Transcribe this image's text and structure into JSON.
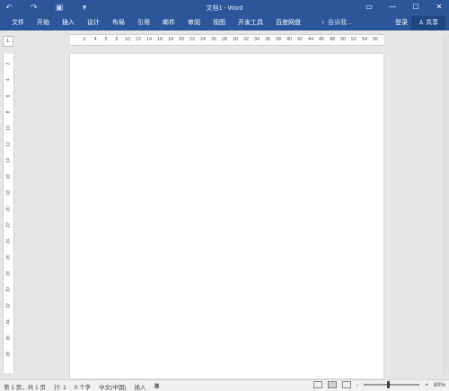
{
  "window": {
    "title": "文档1 - Word"
  },
  "qat": {
    "undo_icon": "undo-icon",
    "redo_icon": "redo-icon",
    "save_icon": "save-icon",
    "customize_icon": "chevron-down-icon"
  },
  "ribbon": {
    "tabs": [
      "文件",
      "开始",
      "插入",
      "设计",
      "布局",
      "引用",
      "邮件",
      "审阅",
      "视图",
      "开发工具",
      "百度网盘"
    ],
    "tell_me": "告诉我...",
    "sign_in": "登录",
    "share": "共享"
  },
  "ruler": {
    "corner": "L",
    "h_ticks": [
      "2",
      "4",
      "6",
      "8",
      "10",
      "12",
      "14",
      "16",
      "18",
      "20",
      "22",
      "24",
      "26",
      "28",
      "30",
      "32",
      "34",
      "36",
      "38",
      "40",
      "42",
      "44",
      "46",
      "48",
      "50",
      "52",
      "54",
      "56"
    ],
    "v_ticks": [
      "2",
      "4",
      "6",
      "8",
      "10",
      "12",
      "14",
      "16",
      "18",
      "20",
      "22",
      "24",
      "26",
      "28",
      "30",
      "32",
      "34",
      "36",
      "38"
    ]
  },
  "status": {
    "page": "第 1 页，共 1 页",
    "line": "行: 1",
    "words": "0 个字",
    "language": "中文(中国)",
    "mode": "插入",
    "zoom": "80%",
    "zoom_minus": "-",
    "zoom_plus": "+"
  }
}
